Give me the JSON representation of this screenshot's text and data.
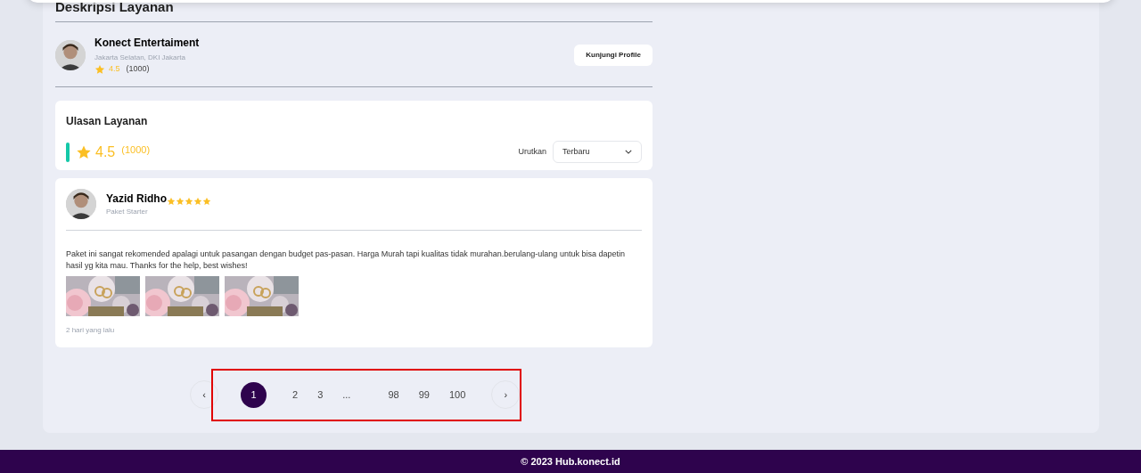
{
  "section_title": "Deskripsi Layanan",
  "provider": {
    "name": "Konect Entertaiment",
    "location": "Jakarta Selatan, DKI Jakarta",
    "rating": "4.5",
    "count": "(1000)",
    "button": "Kunjungi Profile"
  },
  "reviews_summary": {
    "title": "Ulasan Layanan",
    "rating": "4.5",
    "count": "(1000)",
    "sort_label": "Urutkan",
    "sort_value": "Terbaru"
  },
  "reviews": [
    {
      "name": "Yazid Ridho",
      "package": "Paket Starter",
      "stars": 5,
      "text": "Paket ini sangat rekomended apalagi untuk pasangan dengan budget pas-pasan. Harga Murah tapi kualitas tidak murahan.berulang-ulang untuk bisa dapetin hasil yg kita mau. Thanks for the help, best wishes!",
      "photos": [
        {
          "kind": "picture"
        },
        {
          "kind": "picture"
        },
        {
          "kind": "picture"
        }
      ],
      "time": "2 hari yang lalu"
    }
  ],
  "pagination": {
    "prev": "‹",
    "next": "›",
    "highlighted": true,
    "pages": [
      {
        "label": "1",
        "selected": true
      },
      {
        "label": "2",
        "selected": false
      },
      {
        "label": "3",
        "selected": false
      },
      {
        "label": "...",
        "selected": false
      },
      {
        "label": "98",
        "selected": false
      },
      {
        "label": "99",
        "selected": false
      },
      {
        "label": "100",
        "selected": false
      }
    ]
  },
  "footer": "© 2023 Hub.konect.id"
}
